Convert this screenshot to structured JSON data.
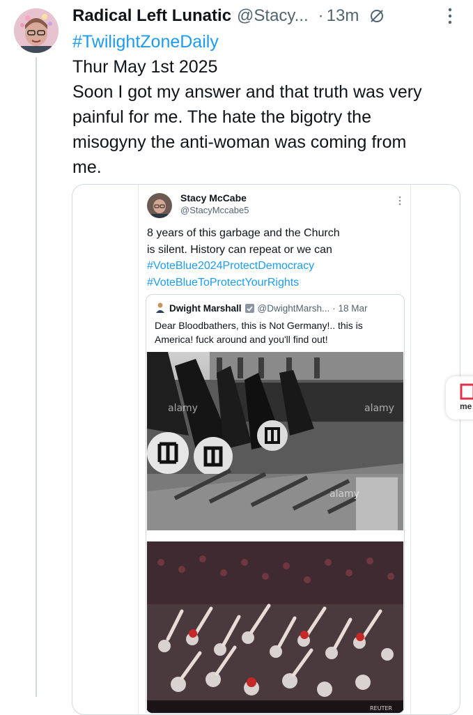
{
  "tweet": {
    "author_name": "Radical Left Lunatic",
    "author_handle": "@Stacy...",
    "separator": "·",
    "time": "13m",
    "hashtag": "#TwilightZoneDaily",
    "date_line": "Thur May 1st 2025",
    "body_lines": [
      "Soon I got my answer and that truth was very",
      "painful for me. The hate the bigotry the",
      "misogyny the anti-woman was coming from",
      "me."
    ]
  },
  "screenshot_post": {
    "author_name": "Stacy McCabe",
    "author_handle": "@StacyMccabe5",
    "text_lines": [
      "8 years of this garbage and the Church",
      "is silent. History can repeat or we can"
    ],
    "hashtags": [
      "#VoteBlue2024ProtectDemocracy",
      "#VoteBlueToProtectYourRights"
    ],
    "quoted": {
      "author_name": "Dwight Marshall",
      "author_handle": "@DwightMarsh...",
      "time": "· 18 Mar",
      "text_lines": [
        "Dear Bloodbathers, this is Not Germany!.. this is",
        "America! fuck around and you'll find out!"
      ],
      "image_watermarks": [
        "alamy",
        "alamy",
        "alamy"
      ],
      "photo_credit": "REUTER"
    }
  },
  "side_badge": {
    "label": "me"
  },
  "colors": {
    "link": "#1d9bf0",
    "secondary_text": "#536471",
    "border": "#cfd9de"
  },
  "icons": [
    "sync-off-icon",
    "more-vertical-icon",
    "verified-badge-icon"
  ]
}
